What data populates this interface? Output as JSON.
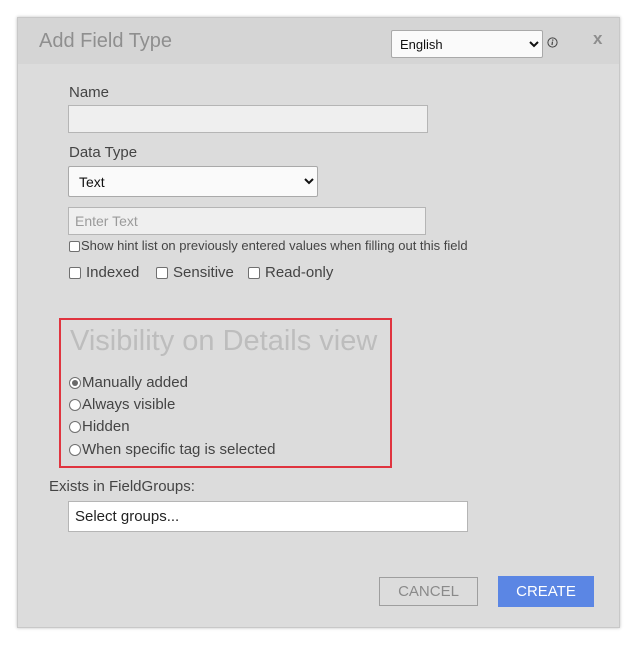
{
  "dialog": {
    "title": "Add Field Type",
    "language": {
      "selected": "English",
      "options": [
        "English"
      ]
    },
    "close_label": "x"
  },
  "form": {
    "name_label": "Name",
    "name_value": "",
    "data_type_label": "Data Type",
    "data_type": {
      "selected": "Text",
      "options": [
        "Text"
      ]
    },
    "text_placeholder": "Enter Text",
    "hint_checkbox_label": "Show hint list on previously entered values when filling out this field",
    "flags": [
      {
        "label": "Indexed",
        "checked": false
      },
      {
        "label": "Sensitive",
        "checked": false
      },
      {
        "label": "Read-only",
        "checked": false
      }
    ]
  },
  "visibility": {
    "title": "Visibility on Details view",
    "options": [
      {
        "label": "Manually added",
        "checked": true
      },
      {
        "label": "Always visible",
        "checked": false
      },
      {
        "label": "Hidden",
        "checked": false
      },
      {
        "label": "When specific tag is selected",
        "checked": false
      }
    ],
    "highlight_color": "#e0343f"
  },
  "field_groups": {
    "label": "Exists in FieldGroups:",
    "placeholder": "Select groups..."
  },
  "actions": {
    "cancel_label": "CANCEL",
    "create_label": "CREATE",
    "create_color": "#5b86e4"
  }
}
